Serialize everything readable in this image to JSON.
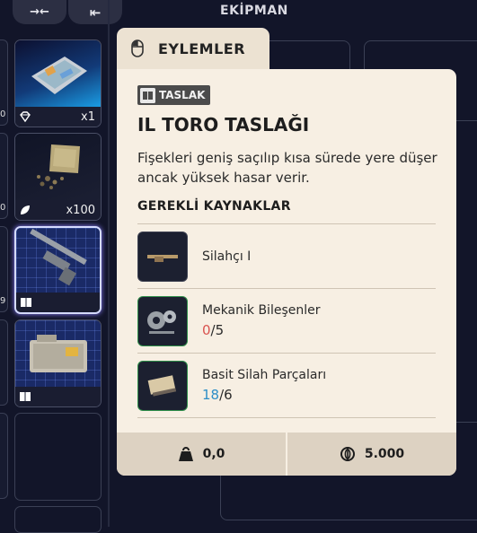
{
  "toolbar": {
    "btn1_icon": "collapse-arrows-icon",
    "btn1_glyph": "→←",
    "btn2_icon": "dock-left-icon",
    "btn2_glyph": "⇤",
    "section_title": "EKİPMAN"
  },
  "left_edge": [
    "0",
    "0",
    "9",
    ""
  ],
  "inventory": [
    {
      "name": "map-pack",
      "qty": "x1",
      "badge_icon": "diamond-icon"
    },
    {
      "name": "seed-pack",
      "qty": "x100",
      "badge_icon": "leaf-icon"
    },
    {
      "name": "il-toro-blueprint",
      "qty": "",
      "badge_icon": "book-icon",
      "selected": true
    },
    {
      "name": "equipment-crate",
      "qty": "",
      "badge_icon": "book-icon"
    },
    {
      "name": "empty",
      "qty": "",
      "badge_icon": ""
    }
  ],
  "tooltip": {
    "tab_label": "EYLEMLER",
    "tab_icon": "mouse-icon",
    "badge_label": "TASLAK",
    "badge_icon": "book-icon",
    "title": "IL TORO TASLAĞI",
    "description": "Fişekleri geniş saçılıp kısa sürede yere düşer ancak yüksek hasar verir.",
    "requirements_title": "GEREKLİ KAYNAKLAR",
    "requirements": [
      {
        "name": "Silahçı I",
        "have": "",
        "need": "",
        "icon": "rifle-icon",
        "state": "none"
      },
      {
        "name": "Mekanik Bileşenler",
        "have": "0",
        "sep": "/",
        "need": "5",
        "icon": "gears-icon",
        "state": "insufficient"
      },
      {
        "name": "Basit Silah Parçaları",
        "have": "18",
        "sep": "/",
        "need": "6",
        "icon": "weapon-parts-icon",
        "state": "sufficient"
      }
    ],
    "weight": "0,0",
    "weight_icon": "weight-icon",
    "price": "5.000",
    "price_icon": "coin-icon"
  },
  "colors": {
    "background": "#121529",
    "card": "#f7efe3",
    "tab": "#ece2d2",
    "insufficient": "#d9534f",
    "sufficient": "#2d8ec7"
  }
}
